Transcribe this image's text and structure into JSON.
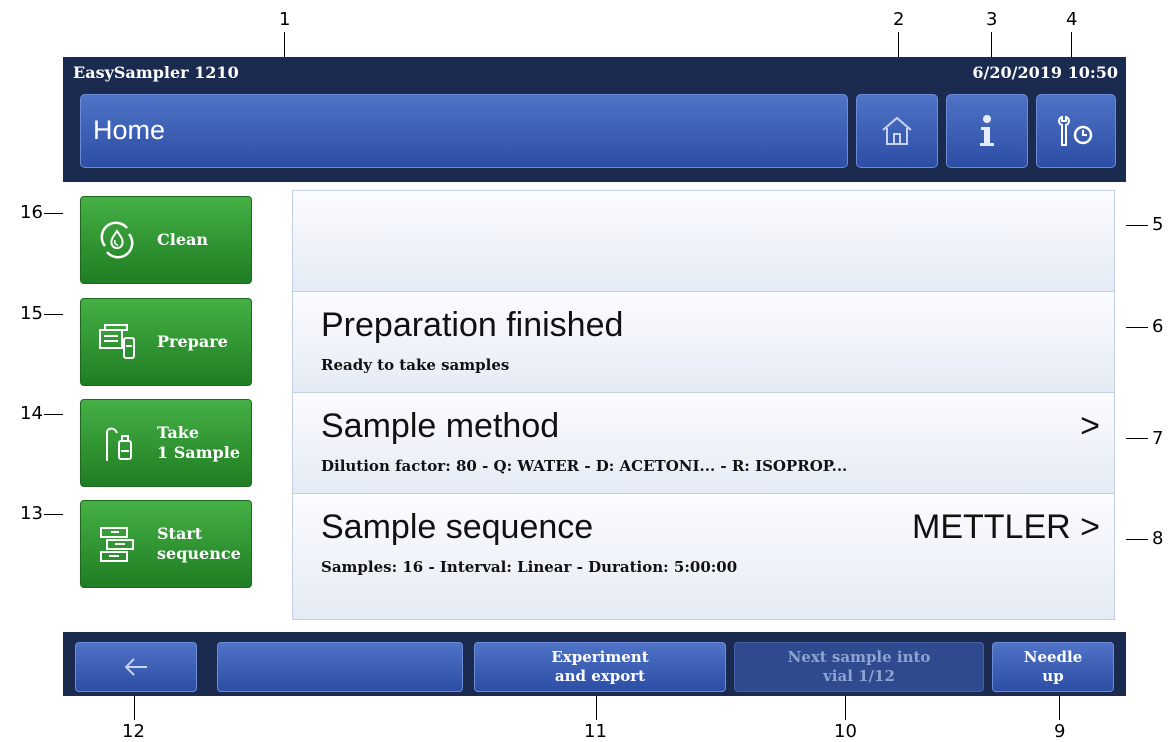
{
  "status_bar": {
    "app_name": "EasySampler 1210",
    "datetime": "6/20/2019 10:50"
  },
  "header": {
    "title": "Home",
    "home_icon": "home-icon",
    "info_icon": "info-icon",
    "settings_icon": "wrench-clock-icon"
  },
  "sidebar": {
    "clean": "Clean",
    "prepare": "Prepare",
    "take_line1": "Take",
    "take_line2": "1 Sample",
    "start_line1": "Start",
    "start_line2": "sequence"
  },
  "panel": {
    "status_text": "",
    "preparation": {
      "title": "Preparation finished",
      "subtitle": "Ready to take samples"
    },
    "method": {
      "title": "Sample method",
      "subtitle": "Dilution factor: 80 - Q: WATER - D: ACETONI... - R: ISOPROP...",
      "chevron": ">"
    },
    "sequence": {
      "title": "Sample sequence",
      "value": "METTLER >",
      "subtitle": "Samples: 16 - Interval: Linear - Duration: 5:00:00"
    }
  },
  "bottom_bar": {
    "back_icon": "arrow-left-icon",
    "export_line1": "Experiment",
    "export_line2": "and export",
    "next_line1": "Next sample into",
    "next_line2": "vial 1/12",
    "needle_line1": "Needle",
    "needle_line2": "up"
  },
  "callouts": [
    "1",
    "2",
    "3",
    "4",
    "5",
    "6",
    "7",
    "8",
    "9",
    "10",
    "11",
    "12",
    "13",
    "14",
    "15",
    "16"
  ],
  "colors": {
    "frame": "#1b2b50",
    "header_button": "#3a5cb5",
    "side_button": "#2f9a33",
    "panel_row": "#eef2f9"
  }
}
